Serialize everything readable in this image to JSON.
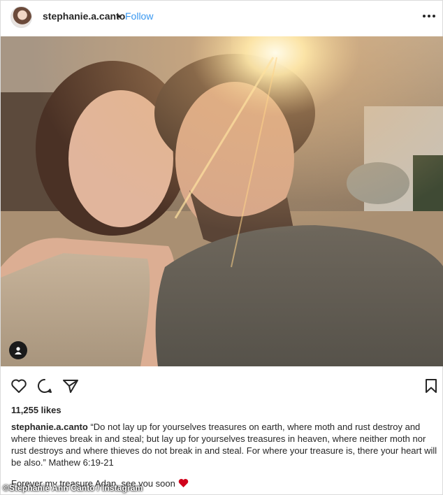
{
  "header": {
    "username": "stephanie.a.canto",
    "separator": "•",
    "follow_label": "Follow",
    "more_icon": "more-horizontal-icon"
  },
  "photo": {
    "description_icon": "user-tag-icon"
  },
  "actions": {
    "like_icon": "heart-icon",
    "comment_icon": "comment-icon",
    "share_icon": "paper-plane-icon",
    "save_icon": "bookmark-icon"
  },
  "likes": "11,255 likes",
  "caption": {
    "username": "stephanie.a.canto",
    "text": "“Do not lay up for yourselves treasures on earth, where moth and rust destroy and where thieves break in and steal; but lay up for yourselves treasures in heaven, where neither moth nor rust destroys and where thieves do not break in and steal. For where your treasure is, there your heart will be also.” Mathew 6:19-21",
    "line2": "Forever my treasure Adan, see you soon",
    "emoji_icon": "red-heart-icon"
  },
  "credit": "©Stephanie Ann Canto / Instagram",
  "colors": {
    "link_blue": "#3897f0",
    "text": "#262626",
    "heart_red": "#d0021b"
  }
}
